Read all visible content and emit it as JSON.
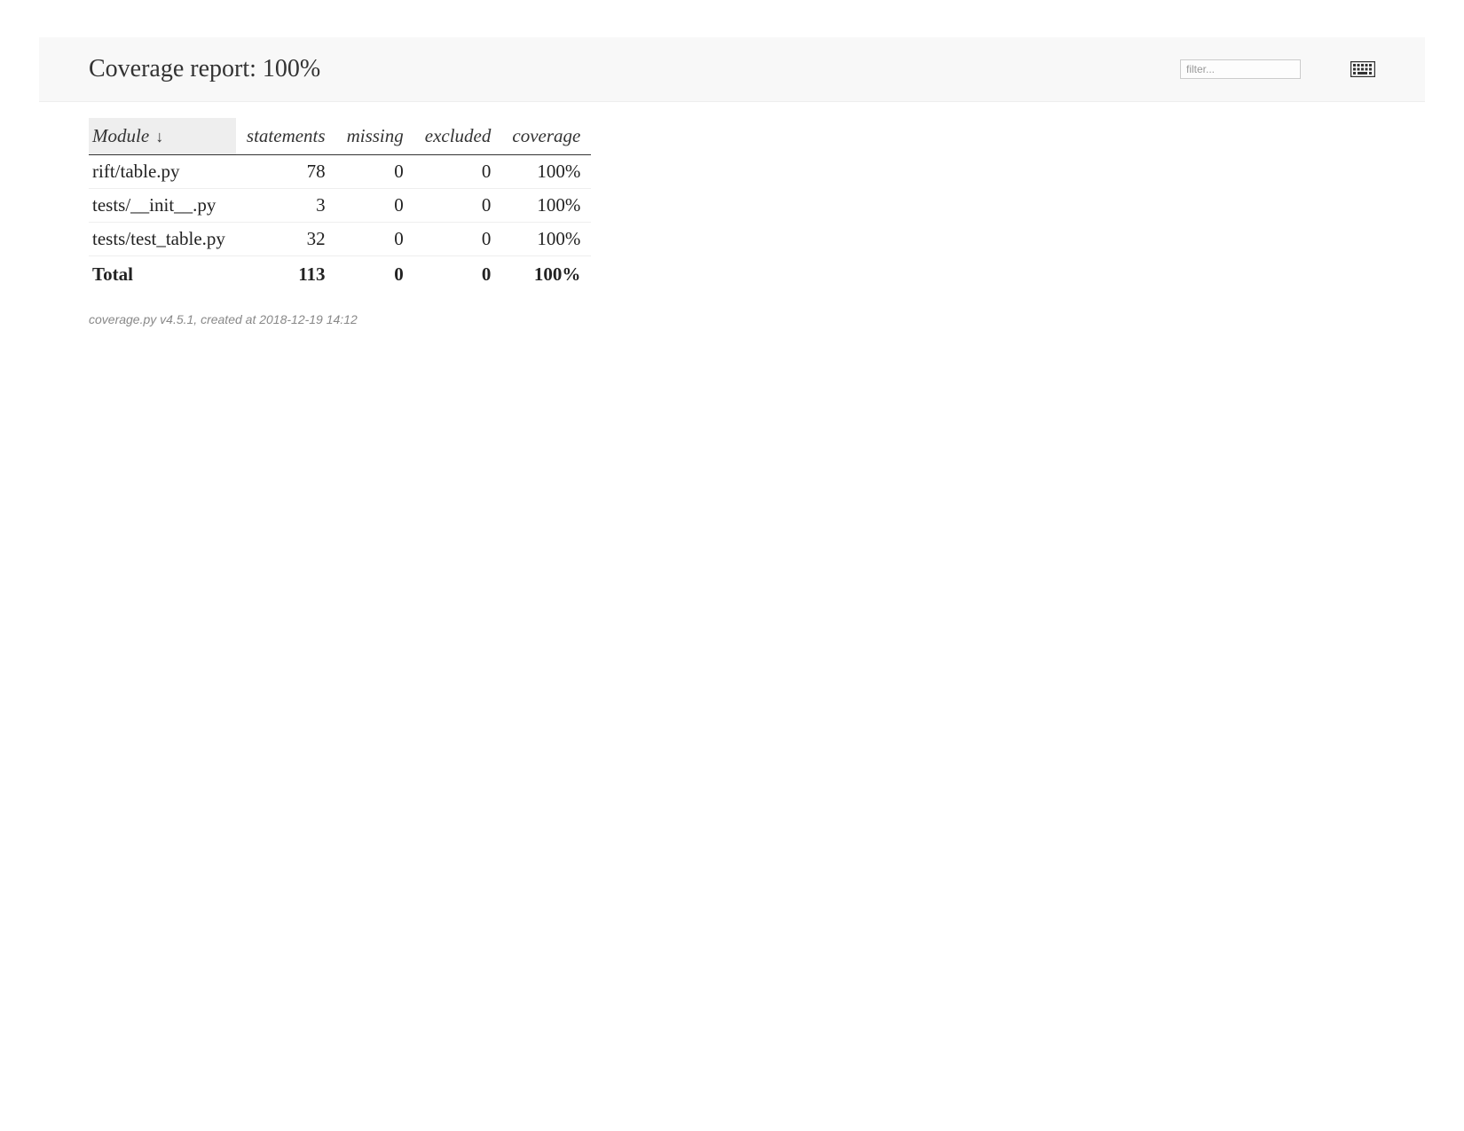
{
  "header": {
    "title": "Coverage report: 100%",
    "filter_placeholder": "filter..."
  },
  "table": {
    "columns": {
      "module": "Module",
      "sort_indicator": "↓",
      "statements": "statements",
      "missing": "missing",
      "excluded": "excluded",
      "coverage": "coverage"
    },
    "rows": [
      {
        "module": "rift/table.py",
        "statements": "78",
        "missing": "0",
        "excluded": "0",
        "coverage": "100%"
      },
      {
        "module": "tests/__init__.py",
        "statements": "3",
        "missing": "0",
        "excluded": "0",
        "coverage": "100%"
      },
      {
        "module": "tests/test_table.py",
        "statements": "32",
        "missing": "0",
        "excluded": "0",
        "coverage": "100%"
      }
    ],
    "total": {
      "label": "Total",
      "statements": "113",
      "missing": "0",
      "excluded": "0",
      "coverage": "100%"
    }
  },
  "footer": {
    "text": "coverage.py v4.5.1, created at 2018-12-19 14:12"
  }
}
